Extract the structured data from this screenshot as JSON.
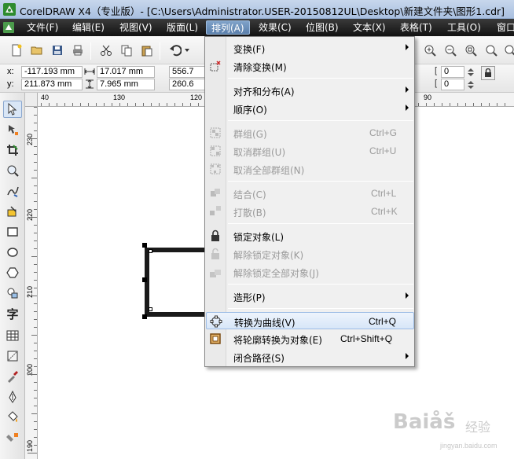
{
  "window": {
    "title": "CorelDRAW X4（专业版）- [C:\\Users\\Administrator.USER-20150812UL\\Desktop\\新建文件夹\\图形1.cdr]"
  },
  "menubar": {
    "items": [
      {
        "label": "文件(F)"
      },
      {
        "label": "编辑(E)"
      },
      {
        "label": "视图(V)"
      },
      {
        "label": "版面(L)"
      },
      {
        "label": "排列(A)"
      },
      {
        "label": "效果(C)"
      },
      {
        "label": "位图(B)"
      },
      {
        "label": "文本(X)"
      },
      {
        "label": "表格(T)"
      },
      {
        "label": "工具(O)"
      },
      {
        "label": "窗口"
      }
    ]
  },
  "property_bar": {
    "x_label": "x:",
    "x_value": "-117.193 mm",
    "y_label": "y:",
    "y_value": "211.873 mm",
    "w_value": "17.017 mm",
    "h_value": "7.965 mm",
    "sx_value": "556.7",
    "sy_value": "260.6",
    "angle1": "0",
    "angle2": "0"
  },
  "rulers": {
    "h_labels": [
      "40",
      "130",
      "120",
      "90"
    ],
    "v_labels": [
      "230",
      "220",
      "210",
      "200",
      "190"
    ]
  },
  "dropdown": {
    "items": [
      {
        "label": "变换(F)",
        "shortcut": "",
        "submenu": true,
        "disabled": false
      },
      {
        "label": "清除变换(M)",
        "shortcut": "",
        "submenu": false,
        "disabled": false
      },
      {
        "label": "对齐和分布(A)",
        "shortcut": "",
        "submenu": true,
        "disabled": false
      },
      {
        "label": "顺序(O)",
        "shortcut": "",
        "submenu": true,
        "disabled": false
      },
      {
        "label": "群组(G)",
        "shortcut": "Ctrl+G",
        "submenu": false,
        "disabled": true
      },
      {
        "label": "取消群组(U)",
        "shortcut": "Ctrl+U",
        "submenu": false,
        "disabled": true
      },
      {
        "label": "取消全部群组(N)",
        "shortcut": "",
        "submenu": false,
        "disabled": true
      },
      {
        "label": "结合(C)",
        "shortcut": "Ctrl+L",
        "submenu": false,
        "disabled": true
      },
      {
        "label": "打散(B)",
        "shortcut": "Ctrl+K",
        "submenu": false,
        "disabled": true
      },
      {
        "label": "锁定对象(L)",
        "shortcut": "",
        "submenu": false,
        "disabled": false
      },
      {
        "label": "解除锁定对象(K)",
        "shortcut": "",
        "submenu": false,
        "disabled": true
      },
      {
        "label": "解除锁定全部对象(J)",
        "shortcut": "",
        "submenu": false,
        "disabled": true
      },
      {
        "label": "造形(P)",
        "shortcut": "",
        "submenu": true,
        "disabled": false
      },
      {
        "label": "转换为曲线(V)",
        "shortcut": "Ctrl+Q",
        "submenu": false,
        "disabled": false,
        "highlighted": true
      },
      {
        "label": "将轮廓转换为对象(E)",
        "shortcut": "Ctrl+Shift+Q",
        "submenu": false,
        "disabled": false
      },
      {
        "label": "闭合路径(S)",
        "shortcut": "",
        "submenu": true,
        "disabled": false
      }
    ]
  },
  "watermark": {
    "brand": "Baiåš",
    "sub": "经验",
    "url": "jingyan.baidu.com"
  },
  "colors": {
    "menubar_dark": "#1e1e1e",
    "highlight": "#d7e6f8",
    "active_menu": "#6a8fbb"
  }
}
